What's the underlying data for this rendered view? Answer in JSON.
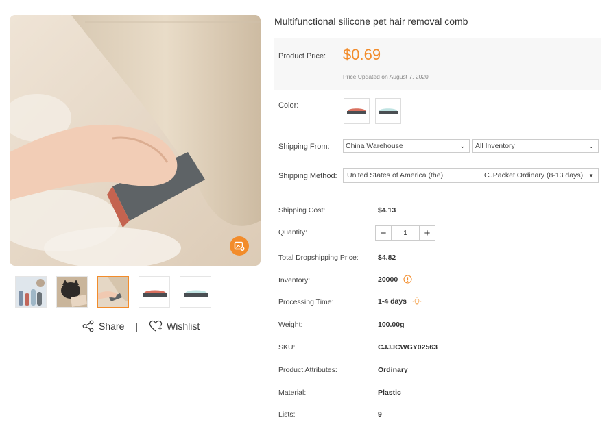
{
  "product": {
    "title": "Multifunctional silicone pet hair removal comb",
    "price_label": "Product Price:",
    "price": "$0.69",
    "price_updated": "Price Updated on August 7, 2020",
    "color_label": "Color:",
    "shipping_from_label": "Shipping From:",
    "shipping_from_value": "China Warehouse",
    "inventory_select_value": "All Inventory",
    "shipping_method_label": "Shipping Method:",
    "shipping_country": "United States of America (the)",
    "shipping_method_value": "CJPacket Ordinary (8-13 days)"
  },
  "gallery": {
    "share_label": "Share",
    "separator": "|",
    "wishlist_label": "Wishlist"
  },
  "details": {
    "shipping_cost_label": "Shipping Cost:",
    "shipping_cost": "$4.13",
    "quantity_label": "Quantity:",
    "quantity": "1",
    "quantity_minus": "−",
    "quantity_plus": "+",
    "total_label": "Total Dropshipping Price:",
    "total": "$4.82",
    "inventory_label": "Inventory:",
    "inventory": "20000",
    "processing_label": "Processing Time:",
    "processing": "1-4 days",
    "weight_label": "Weight:",
    "weight": "100.00g",
    "sku_label": "SKU:",
    "sku": "CJJJCWGY02563",
    "attributes_label": "Product Attributes:",
    "attributes": "Ordinary",
    "material_label": "Material:",
    "material": "Plastic",
    "lists_label": "Lists:",
    "lists": "9"
  },
  "colors": {
    "accent": "#f28c2b",
    "price_bg": "#f7f7f7"
  },
  "icons": [
    "zoom-image-icon",
    "share-icon",
    "heart-plus-icon",
    "info-circle-icon",
    "lightbulb-icon",
    "chevron-down-icon"
  ]
}
